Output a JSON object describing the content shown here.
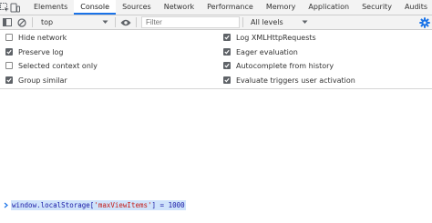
{
  "tabs": [
    {
      "label": "Elements"
    },
    {
      "label": "Console",
      "active": true
    },
    {
      "label": "Sources"
    },
    {
      "label": "Network"
    },
    {
      "label": "Performance"
    },
    {
      "label": "Memory"
    },
    {
      "label": "Application"
    },
    {
      "label": "Security"
    },
    {
      "label": "Audits"
    }
  ],
  "toolbar": {
    "context": "top",
    "filter_placeholder": "Filter",
    "levels": "All levels"
  },
  "settings": {
    "left": [
      {
        "label": "Hide network",
        "checked": false
      },
      {
        "label": "Preserve log",
        "checked": true
      },
      {
        "label": "Selected context only",
        "checked": false
      },
      {
        "label": "Group similar",
        "checked": true
      }
    ],
    "right": [
      {
        "label": "Log XMLHttpRequests",
        "checked": true
      },
      {
        "label": "Eager evaluation",
        "checked": true
      },
      {
        "label": "Autocomplete from history",
        "checked": true
      },
      {
        "label": "Evaluate triggers user activation",
        "checked": true
      }
    ]
  },
  "console": {
    "input_prefix": "window.localStorage[",
    "input_string": "'maxViewItems'",
    "input_suffix": "] = 1000"
  },
  "colors": {
    "accent": "#1a73e8",
    "checkbox": "#5f6368"
  },
  "icons": [
    "inspect-icon",
    "device-toolbar-icon",
    "sidebar-toggle-icon",
    "clear-console-icon",
    "eye-icon",
    "chevron-down-icon",
    "gear-icon",
    "prompt-caret-icon",
    "checkmark-icon"
  ]
}
